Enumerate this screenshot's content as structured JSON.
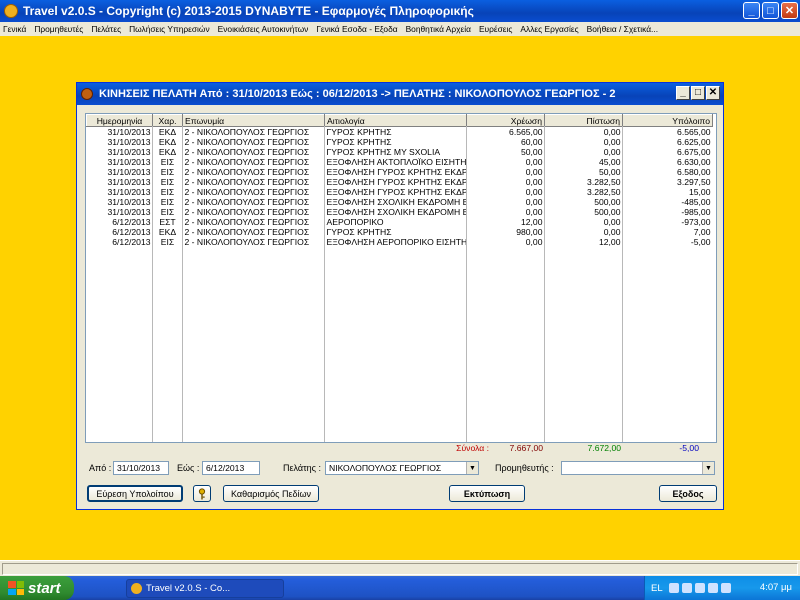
{
  "app": {
    "title": "Travel  v2.0.S  -  Copyright (c)  2013-2015  DYNABYTE - Εφαρμογές Πληροφορικής"
  },
  "menu": [
    "Γενικά",
    "Προμηθευτές",
    "Πελάτες",
    "Πωλήσεις Υπηρεσιών",
    "Ενοικιάσεις Αυτοκινήτων",
    "Γενικά Εσοδα - Εξοδα",
    "Βοηθητικά Αρχεία",
    "Ευρέσεις",
    "Αλλες Εργασίες",
    "Βοήθεια / Σχετικά..."
  ],
  "window": {
    "title": "ΚΙΝΗΣΕΙΣ ΠΕΛΑΤΗ Από : 31/10/2013  Εώς : 06/12/2013  -> ΠΕΛΑΤΗΣ : ΝΙΚΟΛΟΠΟΥΛΟΣ ΓΕΩΡΓΙΟΣ - 2"
  },
  "table": {
    "headers": {
      "date": "Ημερομηνία",
      "type": "Χαρ.",
      "name": "Επωνυμία",
      "reason": "Αιτιολογία",
      "debit": "Χρέωση",
      "credit": "Πίστωση",
      "balance": "Υπόλοιπο"
    },
    "rows": [
      [
        "31/10/2013",
        "ΕΚΔ",
        "2 - ΝΙΚΟΛΟΠΟΥΛΟΣ ΓΕΩΡΓΙΟΣ",
        "ΓΥΡΟΣ ΚΡΗΤΗΣ",
        "6.565,00",
        "0,00",
        "6.565,00"
      ],
      [
        "31/10/2013",
        "ΕΚΔ",
        "2 - ΝΙΚΟΛΟΠΟΥΛΟΣ ΓΕΩΡΓΙΟΣ",
        "ΓΥΡΟΣ ΚΡΗΤΗΣ",
        "60,00",
        "0,00",
        "6.625,00"
      ],
      [
        "31/10/2013",
        "ΕΚΔ",
        "2 - ΝΙΚΟΛΟΠΟΥΛΟΣ ΓΕΩΡΓΙΟΣ",
        "ΓΥΡΟΣ ΚΡΗΤΗΣ ΜΥ SXOLIA",
        "50,00",
        "0,00",
        "6.675,00"
      ],
      [
        "31/10/2013",
        "ΕΙΣ",
        "2 - ΝΙΚΟΛΟΠΟΥΛΟΣ ΓΕΩΡΓΙΟΣ",
        "ΕΞΟΦΛΗΣΗ ΑΚΤΟΠΛΟΪΚΟ ΕΙΣΗΤΗΡΙ",
        "0,00",
        "45,00",
        "6.630,00"
      ],
      [
        "31/10/2013",
        "ΕΙΣ",
        "2 - ΝΙΚΟΛΟΠΟΥΛΟΣ ΓΕΩΡΓΙΟΣ",
        "ΕΞΟΦΛΗΣΗ ΓΥΡΟΣ ΚΡΗΤΗΣ ΕΚΔΡΟ",
        "0,00",
        "50,00",
        "6.580,00"
      ],
      [
        "31/10/2013",
        "ΕΙΣ",
        "2 - ΝΙΚΟΛΟΠΟΥΛΟΣ ΓΕΩΡΓΙΟΣ",
        "ΕΞΟΦΛΗΣΗ ΓΥΡΟΣ ΚΡΗΤΗΣ ΕΚΔΡΟ",
        "0,00",
        "3.282,50",
        "3.297,50"
      ],
      [
        "31/10/2013",
        "ΕΙΣ",
        "2 - ΝΙΚΟΛΟΠΟΥΛΟΣ ΓΕΩΡΓΙΟΣ",
        "ΕΞΟΦΛΗΣΗ ΓΥΡΟΣ ΚΡΗΤΗΣ ΕΚΔΡΟ",
        "0,00",
        "3.282,50",
        "15,00"
      ],
      [
        "31/10/2013",
        "ΕΙΣ",
        "2 - ΝΙΚΟΛΟΠΟΥΛΟΣ ΓΕΩΡΓΙΟΣ",
        "ΕΞΟΦΛΗΣΗ ΣΧΟΛΙΚΗ ΕΚΔΡΟΜΗ ΕΚΔ",
        "0,00",
        "500,00",
        "-485,00"
      ],
      [
        "31/10/2013",
        "ΕΙΣ",
        "2 - ΝΙΚΟΛΟΠΟΥΛΟΣ ΓΕΩΡΓΙΟΣ",
        "ΕΞΟΦΛΗΣΗ ΣΧΟΛΙΚΗ ΕΚΔΡΟΜΗ ΕΚΔ",
        "0,00",
        "500,00",
        "-985,00"
      ],
      [
        "6/12/2013",
        "ΕΣΤ",
        "2 - ΝΙΚΟΛΟΠΟΥΛΟΣ ΓΕΩΡΓΙΟΣ",
        "ΑΕΡΟΠΟΡΙΚΟ",
        "12,00",
        "0,00",
        "-973,00"
      ],
      [
        "6/12/2013",
        "ΕΚΔ",
        "2 - ΝΙΚΟΛΟΠΟΥΛΟΣ ΓΕΩΡΓΙΟΣ",
        "ΓΥΡΟΣ ΚΡΗΤΗΣ",
        "980,00",
        "0,00",
        "7,00"
      ],
      [
        "6/12/2013",
        "ΕΙΣ",
        "2 - ΝΙΚΟΛΟΠΟΥΛΟΣ ΓΕΩΡΓΙΟΣ",
        "ΕΞΟΦΛΗΣΗ ΑΕΡΟΠΟΡΙΚΟ ΕΙΣΗΤΗΡΙΟ",
        "0,00",
        "12,00",
        "-5,00"
      ]
    ],
    "totals": {
      "label": "Σύνολα :",
      "debit": "7.667,00",
      "credit": "7.672,00",
      "balance": "-5,00",
      "label_color": "#c00000",
      "debit_color": "#800000",
      "credit_color": "#008000",
      "balance_color": "#0000c0"
    }
  },
  "filters": {
    "from_label": "Από :",
    "from_value": "31/10/2013",
    "to_label": "Εώς :",
    "to_value": "6/12/2013",
    "customer_label": "Πελάτης :",
    "customer_value": "ΝΙΚΟΛΟΠΟΥΛΟΣ ΓΕΩΡΓΙΟΣ",
    "supplier_label": "Προμηθευτής :",
    "supplier_value": ""
  },
  "buttons": {
    "find_balance": "Εύρεση Υπολοίπου",
    "key_icon": "key-icon",
    "clear_fields": "Καθαρισμός Πεδίων",
    "print": "Εκτύπωση",
    "exit": "Εξοδος"
  },
  "taskbar": {
    "start": "start",
    "task": "Travel  v2.0.S  - Co...",
    "lang": "EL",
    "clock": "4:07 μμ"
  }
}
